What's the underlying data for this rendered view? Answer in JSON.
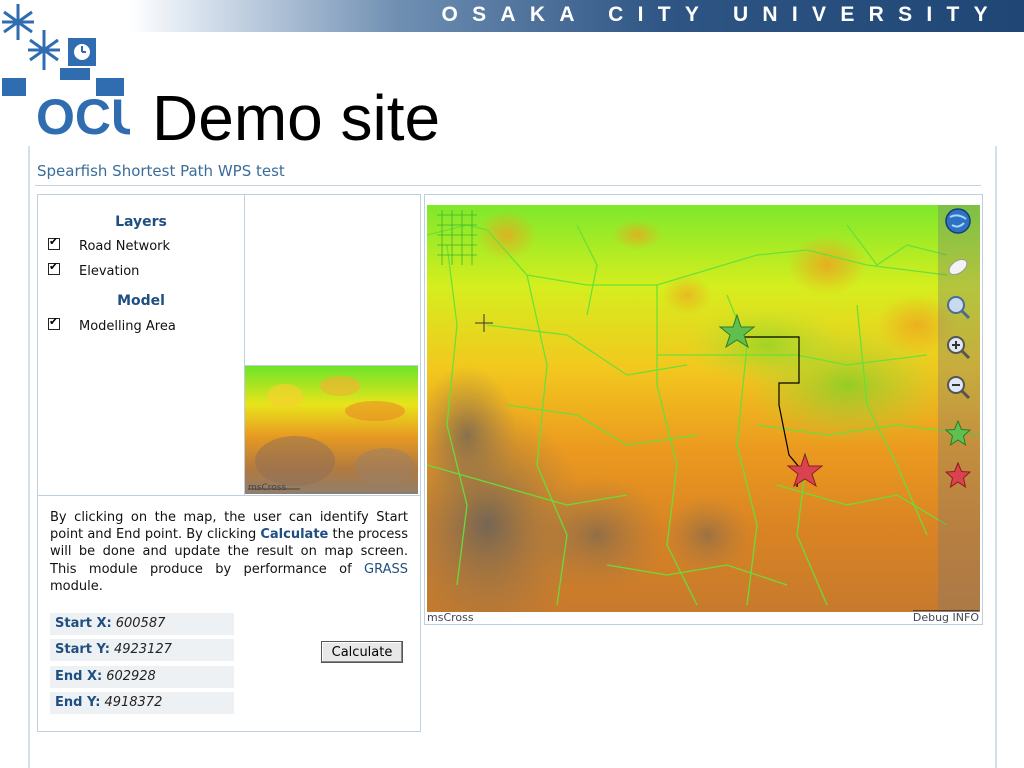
{
  "banner": {
    "university": "OSAKA CITY UNIVERSITY"
  },
  "slide": {
    "title": "Demo site",
    "logo_text": "OCU"
  },
  "app": {
    "title": "Spearfish Shortest Path WPS test",
    "layers_heading": "Layers",
    "layers": [
      {
        "label": "Road Network",
        "checked": true
      },
      {
        "label": "Elevation",
        "checked": true
      }
    ],
    "model_heading": "Model",
    "model_items": [
      {
        "label": "Modelling Area",
        "checked": true
      }
    ],
    "overview_label": "msCross",
    "description": {
      "part1": "By clicking on the map, the user can identify Start point and End point. By clicking ",
      "calc_word": "Calculate",
      "part2": " the process will be done and update the result on map screen. This module produce by performance of ",
      "grass_word": "GRASS",
      "part3": " module."
    },
    "coords": [
      {
        "label": "Start X:",
        "value": "600587"
      },
      {
        "label": "Start Y:",
        "value": "4923127"
      },
      {
        "label": "End X:",
        "value": "602928"
      },
      {
        "label": "End Y:",
        "value": "4918372"
      }
    ],
    "calculate_button": "Calculate",
    "map_footer_left": "msCross",
    "map_footer_right": "Debug INFO",
    "toolbar_icons": [
      "globe-icon",
      "eraser-icon",
      "zoom-box-icon",
      "zoom-in-icon",
      "zoom-out-icon",
      "green-star-icon",
      "red-star-icon"
    ]
  },
  "colors": {
    "banner_dark": "#1f4675",
    "accent_blue": "#1f4f80",
    "start_marker": "#5fbf4f",
    "end_marker": "#d9434f",
    "route": "#000000",
    "roads": "#66e03a"
  }
}
